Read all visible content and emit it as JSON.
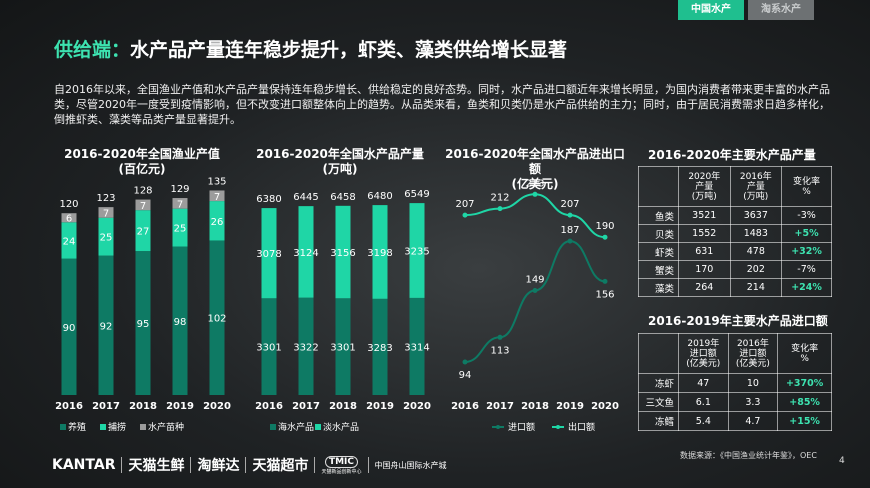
{
  "tabs": [
    {
      "label": "中国水产"
    },
    {
      "label": "淘系水产"
    }
  ],
  "title": {
    "prefix": "供给端：",
    "main": "水产品产量连年稳步提升，虾类、藻类供给增长显著"
  },
  "intro": "自2016年以来，全国渔业产值和水产品产量保持连年稳步增长、供给稳定的良好态势。同时，水产品进口额近年来增长明显，为国内消费者带来更丰富的水产品类，尽管2020年一度受到疫情影响，但不改变进口额整体向上的趋势。从品类来看，鱼类和贝类仍是水产品供给的主力；同时，由于居民消费需求日趋多样化，倒推虾类、藻类等品类产量显著提升。",
  "colors": {
    "dark_green": "#0e7a64",
    "teal": "#1fd6a6",
    "gray": "#9c9c9c",
    "accent": "#3de2b0"
  },
  "chart_data": [
    {
      "type": "bar",
      "stacked": true,
      "title": "2016-2020年全国渔业产值\n(百亿元)",
      "categories": [
        "2016",
        "2017",
        "2018",
        "2019",
        "2020"
      ],
      "series": [
        {
          "name": "养殖",
          "values": [
            90,
            92,
            95,
            98,
            102
          ],
          "color": "#0e7a64"
        },
        {
          "name": "捕捞",
          "values": [
            24,
            25,
            27,
            25,
            26
          ],
          "color": "#1fd6a6"
        },
        {
          "name": "水产苗种",
          "values": [
            6,
            7,
            7,
            7,
            7
          ],
          "color": "#9c9c9c"
        }
      ],
      "totals": [
        120,
        123,
        128,
        129,
        135
      ]
    },
    {
      "type": "bar",
      "stacked": true,
      "title": "2016-2020年全国水产品产量\n(万吨)",
      "categories": [
        "2016",
        "2017",
        "2018",
        "2019",
        "2020"
      ],
      "series": [
        {
          "name": "海水产品",
          "values": [
            3301,
            3322,
            3301,
            3283,
            3314
          ],
          "color": "#0e7a64"
        },
        {
          "name": "淡水产品",
          "values": [
            3078,
            3124,
            3156,
            3198,
            3235
          ],
          "color": "#1fd6a6"
        }
      ],
      "totals": [
        6380,
        6445,
        6458,
        6480,
        6549
      ]
    },
    {
      "type": "line",
      "title": "2016-2020年全国水产品进出口额\n(亿美元)",
      "categories": [
        "2016",
        "2017",
        "2018",
        "2019",
        "2020"
      ],
      "series": [
        {
          "name": "进口额",
          "values": [
            94,
            113,
            149,
            187,
            156
          ],
          "color": "#0e7a64"
        },
        {
          "name": "出口额",
          "values": [
            207,
            212,
            223,
            207,
            190
          ],
          "color": "#1fd6a6"
        }
      ]
    },
    {
      "type": "table",
      "title": "2016-2020年主要水产品产量",
      "headers": [
        "",
        "2020年\n产量\n(万吨)",
        "2016年\n产量\n(万吨)",
        "变化率\n%"
      ],
      "rows": [
        {
          "label": "鱼类",
          "v2020": "3521",
          "v2016": "3637",
          "change": "-3%",
          "positive": false
        },
        {
          "label": "贝类",
          "v2020": "1552",
          "v2016": "1483",
          "change": "+5%",
          "positive": true
        },
        {
          "label": "虾类",
          "v2020": "631",
          "v2016": "478",
          "change": "+32%",
          "positive": true
        },
        {
          "label": "蟹类",
          "v2020": "170",
          "v2016": "202",
          "change": "-7%",
          "positive": false
        },
        {
          "label": "藻类",
          "v2020": "264",
          "v2016": "214",
          "change": "+24%",
          "positive": true
        }
      ]
    },
    {
      "type": "table",
      "title": "2016-2019年主要水产品进口额",
      "headers": [
        "",
        "2019年\n进口额\n(亿美元)",
        "2016年\n进口额\n(亿美元)",
        "变化率\n%"
      ],
      "rows": [
        {
          "label": "冻虾",
          "v2019": "47",
          "v2016": "10",
          "change": "+370%",
          "positive": true
        },
        {
          "label": "三文鱼",
          "v2019": "6.1",
          "v2016": "3.3",
          "change": "+85%",
          "positive": true
        },
        {
          "label": "冻鳕",
          "v2019": "5.4",
          "v2016": "4.7",
          "change": "+15%",
          "positive": true
        }
      ]
    }
  ],
  "source": "数据来源：《中国渔业统计年鉴》，OEC",
  "page_number": "4",
  "footer": {
    "logos": [
      "KANTAR",
      "天猫生鲜",
      "淘鲜达",
      "天猫超市",
      "TMIC",
      "中国舟山国际水产城"
    ],
    "tmic_sub": "天猫新品创新中心"
  }
}
